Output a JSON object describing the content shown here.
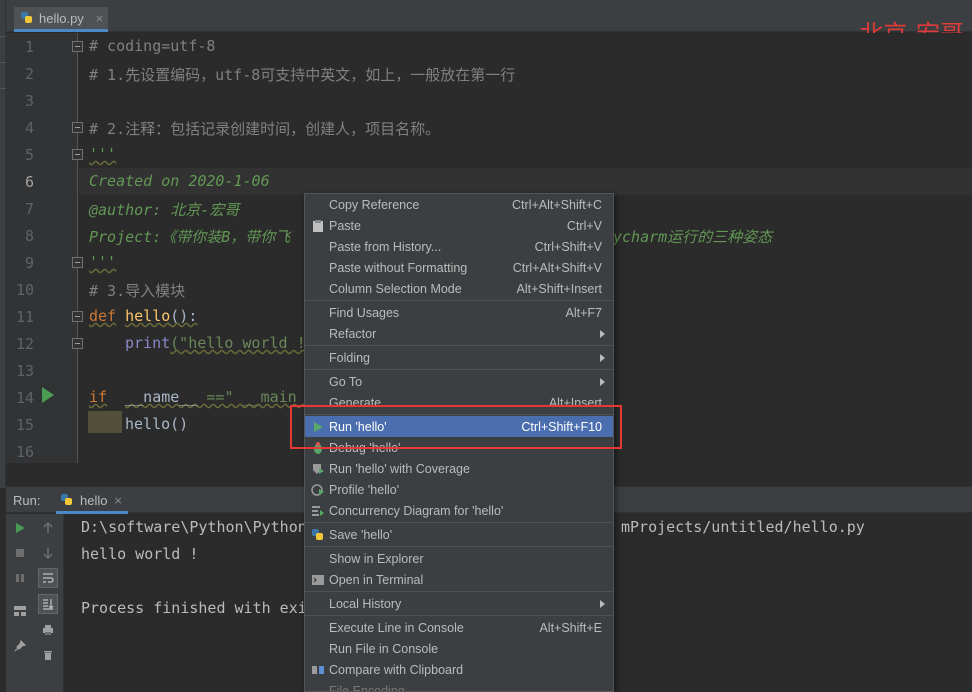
{
  "editor_tab": {
    "filename": "hello.py",
    "close": "×"
  },
  "watermark": "北京-宏哥",
  "line_numbers": [
    "1",
    "2",
    "3",
    "4",
    "5",
    "6",
    "7",
    "8",
    "9",
    "10",
    "11",
    "12",
    "13",
    "14",
    "15",
    "16"
  ],
  "code": {
    "l1": "# coding=utf-8",
    "l2": "# 1.先设置编码，utf-8可支持中英文，如上，一般放在第一行",
    "l4": "# 2.注释：包括记录创建时间，创建人，项目名称。",
    "l5": "'''",
    "l6": "Created on 2020-1-06",
    "l7": "@author: 北京-宏哥",
    "l8_a": "Project:《带你装B，带你飞",
    "l8_b": "ycharm运行的三种姿态",
    "l9": "'''",
    "l10": "# 3.导入模块",
    "l11_kw": "def",
    "l11_fn": "hello",
    "l11_rest": "():",
    "l12_fn": "print",
    "l12_rest": "(\"hello world !",
    "l14_kw": "if",
    "l14_name": "__name__",
    "l14_rest": " ==\" ",
    "l14_main": "__main__",
    "l14_end": "\":",
    "l15": "hello()"
  },
  "run_panel": {
    "title": "Run:",
    "tab_label": "hello",
    "tab_close": "×",
    "console": {
      "line1_a": "D:\\software\\Python\\Python",
      "line1_b": "mProjects/untitled/hello.py",
      "line2": "hello world !",
      "line4": "Process finished with exi"
    }
  },
  "context_menu": {
    "items": [
      {
        "label": "Copy Reference",
        "shortcut": "Ctrl+Alt+Shift+C"
      },
      {
        "label": "Paste",
        "shortcut": "Ctrl+V"
      },
      {
        "label": "Paste from History...",
        "shortcut": "Ctrl+Shift+V"
      },
      {
        "label": "Paste without Formatting",
        "shortcut": "Ctrl+Alt+Shift+V"
      },
      {
        "label": "Column Selection Mode",
        "shortcut": "Alt+Shift+Insert"
      },
      {
        "label": "Find Usages",
        "shortcut": "Alt+F7"
      },
      {
        "label": "Refactor",
        "shortcut": ""
      },
      {
        "label": "Folding",
        "shortcut": ""
      },
      {
        "label": "Go To",
        "shortcut": ""
      },
      {
        "label": "Generate...",
        "shortcut": "Alt+Insert"
      },
      {
        "label": "Run 'hello'",
        "shortcut": "Ctrl+Shift+F10"
      },
      {
        "label": "Debug 'hello'",
        "shortcut": ""
      },
      {
        "label": "Run 'hello' with Coverage",
        "shortcut": ""
      },
      {
        "label": "Profile 'hello'",
        "shortcut": ""
      },
      {
        "label": "Concurrency Diagram for 'hello'",
        "shortcut": ""
      },
      {
        "label": "Save 'hello'",
        "shortcut": ""
      },
      {
        "label": "Show in Explorer",
        "shortcut": ""
      },
      {
        "label": "Open in Terminal",
        "shortcut": ""
      },
      {
        "label": "Local History",
        "shortcut": ""
      },
      {
        "label": "Execute Line in Console",
        "shortcut": "Alt+Shift+E"
      },
      {
        "label": "Run File in Console",
        "shortcut": ""
      },
      {
        "label": "Compare with Clipboard",
        "shortcut": ""
      },
      {
        "label": "File Encoding",
        "shortcut": ""
      }
    ]
  },
  "colors": {
    "editor_bg": "#2b2b2b",
    "panel_bg": "#3c3f41",
    "selection": "#4b6eaf",
    "highlight_box": "#e53935",
    "watermark": "#e03b3b"
  }
}
